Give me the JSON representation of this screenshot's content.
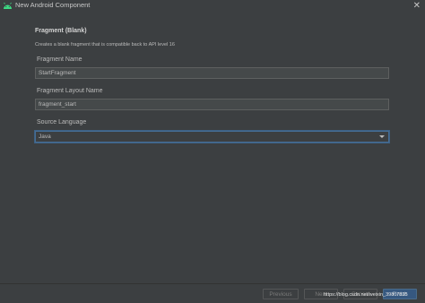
{
  "window": {
    "title": "New Android Component",
    "icon": "android-icon",
    "close_glyph": "✕"
  },
  "header": {
    "title": "Fragment (Blank)",
    "description": "Creates a blank fragment that is compatible back to API level 16"
  },
  "fields": {
    "fragment_name": {
      "label": "Fragment Name",
      "value": "StartFragment"
    },
    "layout_name": {
      "label": "Fragment Layout Name",
      "value": "fragment_start"
    },
    "source_language": {
      "label": "Source Language",
      "value": "Java"
    }
  },
  "footer": {
    "previous_label": "Previous",
    "next_label": "Next",
    "cancel_label": "Cancel",
    "finish_label": "Finish",
    "watermark": "https://blog.csdn.net/weixin_39807835"
  },
  "colors": {
    "background": "#3c3f41",
    "input_background": "#45494a",
    "focus_border": "#466d94",
    "android_green": "#3ddc84"
  }
}
